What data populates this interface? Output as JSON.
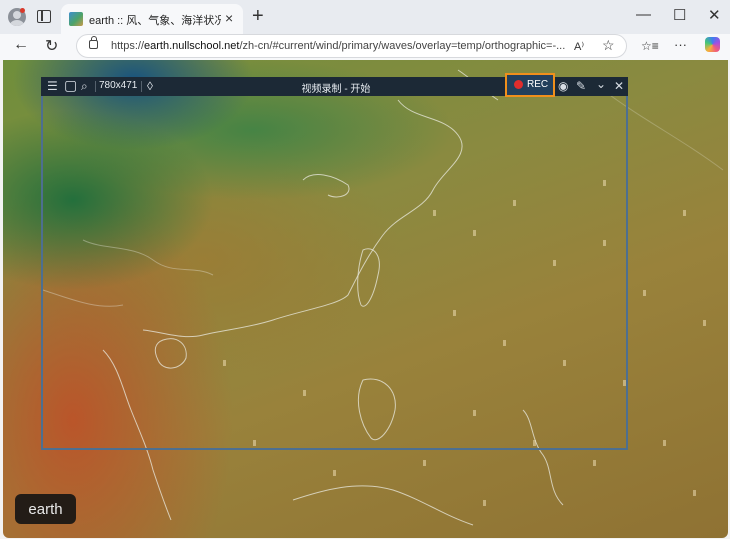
{
  "browser": {
    "tab": {
      "title": "earth :: 风、气象、海洋状况的全球地图",
      "close_icon": "×"
    },
    "newtab_icon": "+",
    "window_controls": {
      "minimize": "—",
      "maximize": "☐",
      "close": "✕"
    },
    "nav": {
      "back": "←",
      "reload": "↻"
    },
    "address": {
      "url_prefix": "https://",
      "url_host": "earth.nullschool.net",
      "url_path": "/zh-cn/#current/wind/primary/waves/overlay=temp/orthographic=-..."
    },
    "toolbar": {
      "read_aloud": "A⁾",
      "favorite": "☆",
      "favorites_list": "☆≡",
      "more": "···"
    }
  },
  "recorder": {
    "menu_icon": "☰",
    "region_icon": "▢",
    "search_region_icon": "⌕",
    "size": "780x471",
    "drop_icon": "◊",
    "title": "视频录制 - 开始",
    "rec_label": "REC",
    "camera_icon": "◉",
    "pen_icon": "✎",
    "collapse_icon": "⌄",
    "close_icon": "✕",
    "accent_color": "#f0901c"
  },
  "map": {
    "badge": "earth"
  }
}
